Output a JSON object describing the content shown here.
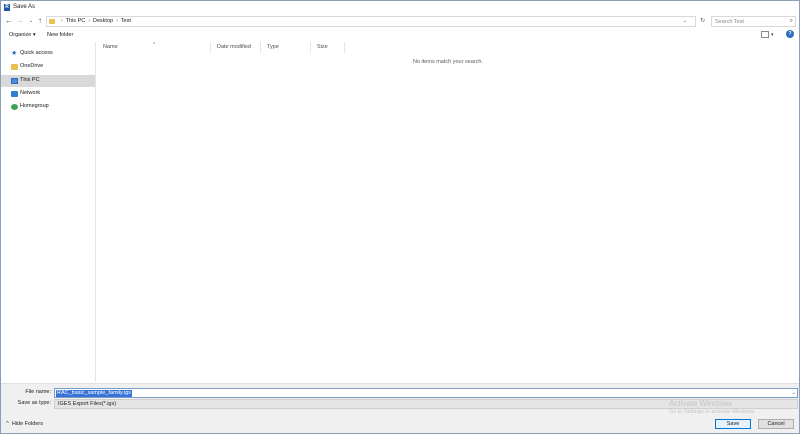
{
  "window": {
    "title": "Save As",
    "app_icon_letter": "R"
  },
  "address": {
    "crumbs": [
      "This PC",
      "Desktop",
      "Test"
    ],
    "search_placeholder": "Search Test"
  },
  "toolbar": {
    "organize_label": "Organize ▾",
    "new_folder_label": "New folder"
  },
  "nav": {
    "items": [
      {
        "label": "Quick access",
        "icon": "star-icon"
      },
      {
        "label": "OneDrive",
        "icon": "folder-icon"
      },
      {
        "label": "This PC",
        "icon": "computer-icon",
        "selected": true
      },
      {
        "label": "Network",
        "icon": "network-icon"
      },
      {
        "label": "Homegroup",
        "icon": "homegroup-icon"
      }
    ]
  },
  "filelist": {
    "columns": [
      "Name",
      "Date modified",
      "Type",
      "Size"
    ],
    "empty_message": "No items match your search."
  },
  "bottom": {
    "filename_label": "File name:",
    "filename_value": "RAC_basic_sample_family.igs",
    "savetype_label": "Save as type:",
    "savetype_value": "IGES Export Files(*.igs)",
    "hide_folders_label": "Hide Folders",
    "save_label": "Save",
    "cancel_label": "Cancel"
  },
  "watermark": {
    "title": "Activate Windows",
    "subtitle": "Go to Settings to activate Windows."
  }
}
